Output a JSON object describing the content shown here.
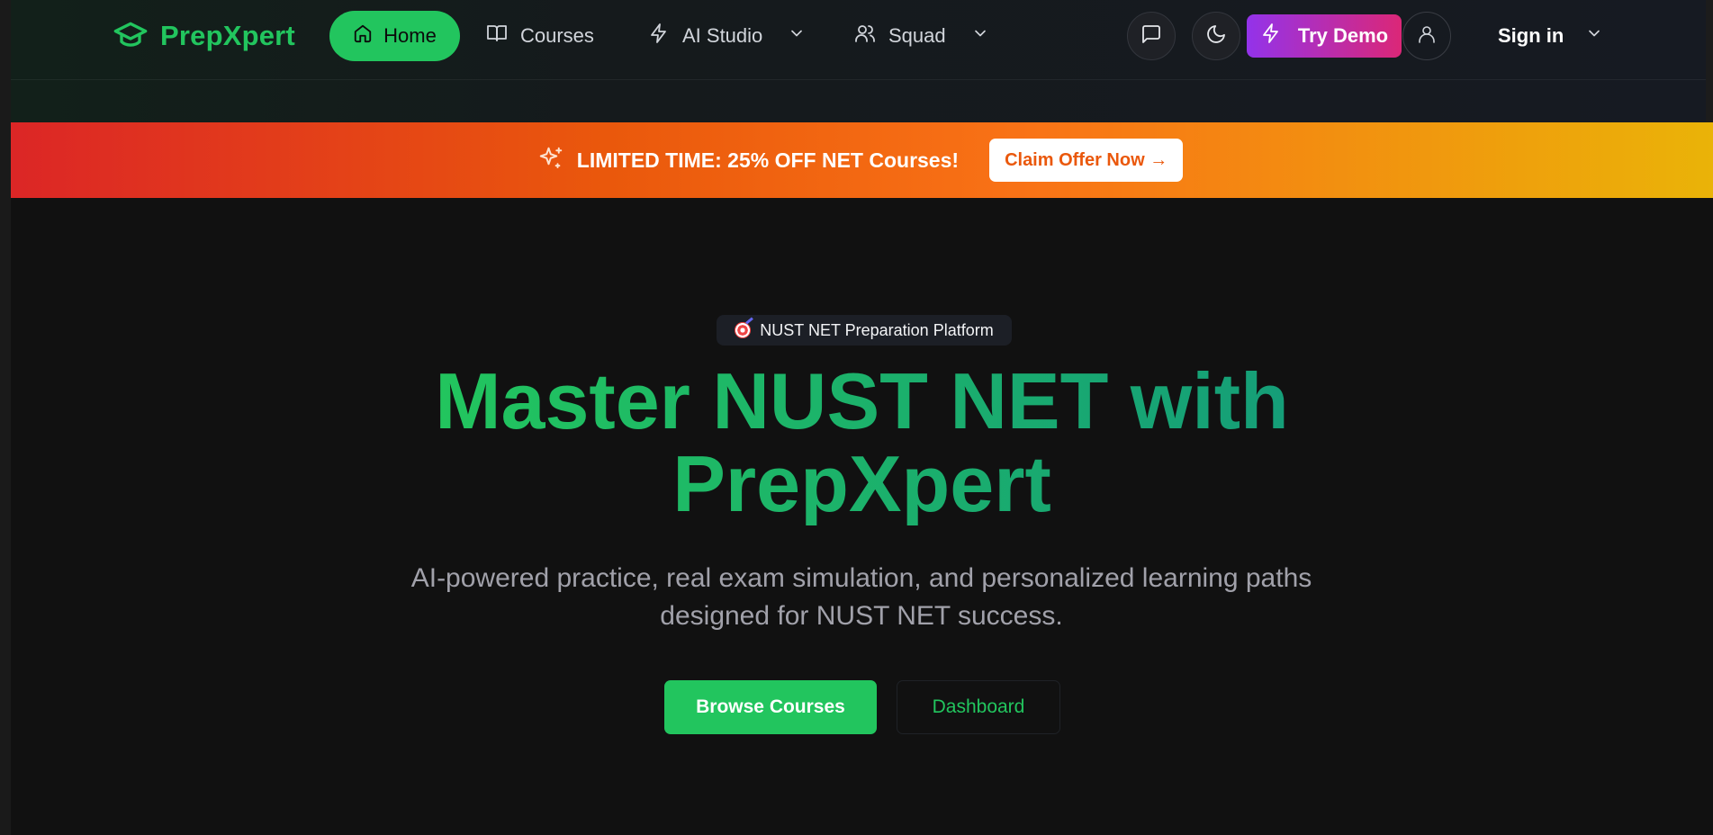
{
  "brand": {
    "name": "PrepXpert",
    "accent": "#22c55e",
    "icon": "graduation-cap-icon"
  },
  "nav": {
    "home": {
      "label": "Home",
      "icon": "home-icon"
    },
    "courses": {
      "label": "Courses",
      "icon": "book-open-icon"
    },
    "ai_studio": {
      "label": "AI Studio",
      "icon": "zap-icon"
    },
    "squad": {
      "label": "Squad",
      "icon": "users-icon"
    }
  },
  "actions": {
    "chat_icon": "message-square-icon",
    "theme_icon": "moon-icon",
    "try_demo": {
      "label": "Try Demo",
      "icon": "zap-icon",
      "gradient": [
        "#9333ea",
        "#db2777"
      ]
    },
    "user_icon": "user-icon",
    "sign_in": "Sign in"
  },
  "promo": {
    "icon": "sparkles-icon",
    "text": "LIMITED TIME: 25% OFF NET Courses!",
    "cta": "Claim Offer Now →",
    "gradient": [
      "#dc2626",
      "#f97316",
      "#eab308"
    ]
  },
  "hero": {
    "badge": "NUST NET Preparation Platform",
    "badge_icon": "target-icon",
    "headline_line1": "Master NUST NET with",
    "headline_line2": "PrepXpert",
    "subtext_line1": "AI-powered practice, real exam simulation, and personalized learning paths",
    "subtext_line2": "designed for NUST NET success.",
    "primary_button": "Browse Courses",
    "secondary_button": "Dashboard"
  }
}
